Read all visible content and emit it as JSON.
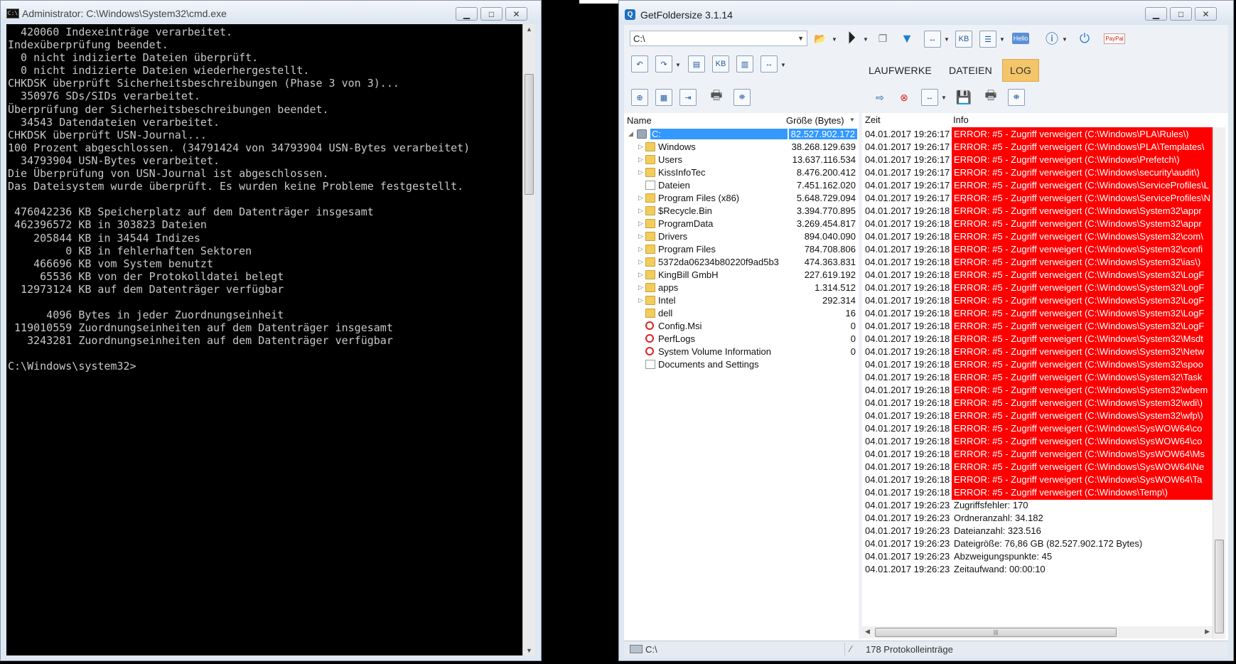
{
  "cmd": {
    "title": "Administrator: C:\\Windows\\System32\\cmd.exe",
    "icon_text": "C:\\",
    "output": "  420060 Indexeinträge verarbeitet.\nIndexüberprüfung beendet.\n  0 nicht indizierte Dateien überprüft.\n  0 nicht indizierte Dateien wiederhergestellt.\nCHKDSK überprüft Sicherheitsbeschreibungen (Phase 3 von 3)...\n  350976 SDs/SIDs verarbeitet.\nÜberprüfung der Sicherheitsbeschreibungen beendet.\n  34543 Datendateien verarbeitet.\nCHKDSK überprüft USN-Journal...\n100 Prozent abgeschlossen. (34791424 von 34793904 USN-Bytes verarbeitet)\n  34793904 USN-Bytes verarbeitet.\nDie Überprüfung von USN-Journal ist abgeschlossen.\nDas Dateisystem wurde überprüft. Es wurden keine Probleme festgestellt.\n\n 476042236 KB Speicherplatz auf dem Datenträger insgesamt\n 462396572 KB in 303823 Dateien\n    205844 KB in 34544 Indizes\n         0 KB in fehlerhaften Sektoren\n    466696 KB vom System benutzt\n     65536 KB von der Protokolldatei belegt\n  12973124 KB auf dem Datenträger verfügbar\n\n      4096 Bytes in jeder Zuordnungseinheit\n 119010559 Zuordnungseinheiten auf dem Datenträger insgesamt\n   3243281 Zuordnungseinheiten auf dem Datenträger verfügbar\n\nC:\\Windows\\system32>"
  },
  "gfs": {
    "title": "GetFoldersize 3.1.14",
    "path_value": "C:\\",
    "tabs": [
      {
        "label": "LAUFWERKE"
      },
      {
        "label": "DATEIEN"
      },
      {
        "label": "LOG"
      }
    ],
    "toolbar_labels": {
      "kb": "KB",
      "hello": "Hello",
      "paypal": "PayPal"
    },
    "tree_headers": {
      "name": "Name",
      "size": "Größe (Bytes)"
    },
    "tree": [
      {
        "name": "C:",
        "size": "82.527.902.172",
        "type": "drive"
      },
      {
        "name": "Windows",
        "size": "38.268.129.639",
        "type": "folder"
      },
      {
        "name": "Users",
        "size": "13.637.116.534",
        "type": "folder"
      },
      {
        "name": "KissInfoTec",
        "size": "8.476.200.412",
        "type": "folder"
      },
      {
        "name": "Dateien",
        "size": "7.451.162.020",
        "type": "file"
      },
      {
        "name": "Program Files (x86)",
        "size": "5.648.729.094",
        "type": "folder"
      },
      {
        "name": "$Recycle.Bin",
        "size": "3.394.770.895",
        "type": "folder"
      },
      {
        "name": "ProgramData",
        "size": "3.269.454.817",
        "type": "folder"
      },
      {
        "name": "Drivers",
        "size": "894.040.090",
        "type": "folder"
      },
      {
        "name": "Program Files",
        "size": "784.708.806",
        "type": "folder"
      },
      {
        "name": "5372da06234b80220f9ad5b3",
        "size": "474.363.831",
        "type": "folder"
      },
      {
        "name": "KingBill GmbH",
        "size": "227.619.192",
        "type": "folder"
      },
      {
        "name": "apps",
        "size": "1.314.512",
        "type": "folder"
      },
      {
        "name": "Intel",
        "size": "292.314",
        "type": "folder"
      },
      {
        "name": "dell",
        "size": "16",
        "type": "folder"
      },
      {
        "name": "Config.Msi",
        "size": "0",
        "type": "noent"
      },
      {
        "name": "PerfLogs",
        "size": "0",
        "type": "noent"
      },
      {
        "name": "System Volume Information",
        "size": "0",
        "type": "noent"
      },
      {
        "name": "Documents and Settings",
        "size": "",
        "type": "link"
      }
    ],
    "log_headers": {
      "time": "Zeit",
      "info": "Info"
    },
    "log": [
      {
        "time": "04.01.2017 19:26:17",
        "info": "ERROR: #5 - Zugriff verweigert (C:\\Windows\\PLA\\Rules\\)",
        "error": true
      },
      {
        "time": "04.01.2017 19:26:17",
        "info": "ERROR: #5 - Zugriff verweigert (C:\\Windows\\PLA\\Templates\\",
        "error": true
      },
      {
        "time": "04.01.2017 19:26:17",
        "info": "ERROR: #5 - Zugriff verweigert (C:\\Windows\\Prefetch\\)",
        "error": true
      },
      {
        "time": "04.01.2017 19:26:17",
        "info": "ERROR: #5 - Zugriff verweigert (C:\\Windows\\security\\audit\\)",
        "error": true
      },
      {
        "time": "04.01.2017 19:26:17",
        "info": "ERROR: #5 - Zugriff verweigert (C:\\Windows\\ServiceProfiles\\L",
        "error": true
      },
      {
        "time": "04.01.2017 19:26:17",
        "info": "ERROR: #5 - Zugriff verweigert (C:\\Windows\\ServiceProfiles\\N",
        "error": true
      },
      {
        "time": "04.01.2017 19:26:18",
        "info": "ERROR: #5 - Zugriff verweigert (C:\\Windows\\System32\\appr",
        "error": true
      },
      {
        "time": "04.01.2017 19:26:18",
        "info": "ERROR: #5 - Zugriff verweigert (C:\\Windows\\System32\\appr",
        "error": true
      },
      {
        "time": "04.01.2017 19:26:18",
        "info": "ERROR: #5 - Zugriff verweigert (C:\\Windows\\System32\\com\\",
        "error": true
      },
      {
        "time": "04.01.2017 19:26:18",
        "info": "ERROR: #5 - Zugriff verweigert (C:\\Windows\\System32\\confi",
        "error": true
      },
      {
        "time": "04.01.2017 19:26:18",
        "info": "ERROR: #5 - Zugriff verweigert (C:\\Windows\\System32\\ias\\)",
        "error": true
      },
      {
        "time": "04.01.2017 19:26:18",
        "info": "ERROR: #5 - Zugriff verweigert (C:\\Windows\\System32\\LogF",
        "error": true
      },
      {
        "time": "04.01.2017 19:26:18",
        "info": "ERROR: #5 - Zugriff verweigert (C:\\Windows\\System32\\LogF",
        "error": true
      },
      {
        "time": "04.01.2017 19:26:18",
        "info": "ERROR: #5 - Zugriff verweigert (C:\\Windows\\System32\\LogF",
        "error": true
      },
      {
        "time": "04.01.2017 19:26:18",
        "info": "ERROR: #5 - Zugriff verweigert (C:\\Windows\\System32\\LogF",
        "error": true
      },
      {
        "time": "04.01.2017 19:26:18",
        "info": "ERROR: #5 - Zugriff verweigert (C:\\Windows\\System32\\LogF",
        "error": true
      },
      {
        "time": "04.01.2017 19:26:18",
        "info": "ERROR: #5 - Zugriff verweigert (C:\\Windows\\System32\\Msdt",
        "error": true
      },
      {
        "time": "04.01.2017 19:26:18",
        "info": "ERROR: #5 - Zugriff verweigert (C:\\Windows\\System32\\Netw",
        "error": true
      },
      {
        "time": "04.01.2017 19:26:18",
        "info": "ERROR: #5 - Zugriff verweigert (C:\\Windows\\System32\\spoo",
        "error": true
      },
      {
        "time": "04.01.2017 19:26:18",
        "info": "ERROR: #5 - Zugriff verweigert (C:\\Windows\\System32\\Task",
        "error": true
      },
      {
        "time": "04.01.2017 19:26:18",
        "info": "ERROR: #5 - Zugriff verweigert (C:\\Windows\\System32\\wbem",
        "error": true
      },
      {
        "time": "04.01.2017 19:26:18",
        "info": "ERROR: #5 - Zugriff verweigert (C:\\Windows\\System32\\wdi\\)",
        "error": true
      },
      {
        "time": "04.01.2017 19:26:18",
        "info": "ERROR: #5 - Zugriff verweigert (C:\\Windows\\System32\\wfp\\)",
        "error": true
      },
      {
        "time": "04.01.2017 19:26:18",
        "info": "ERROR: #5 - Zugriff verweigert (C:\\Windows\\SysWOW64\\co",
        "error": true
      },
      {
        "time": "04.01.2017 19:26:18",
        "info": "ERROR: #5 - Zugriff verweigert (C:\\Windows\\SysWOW64\\co",
        "error": true
      },
      {
        "time": "04.01.2017 19:26:18",
        "info": "ERROR: #5 - Zugriff verweigert (C:\\Windows\\SysWOW64\\Ms",
        "error": true
      },
      {
        "time": "04.01.2017 19:26:18",
        "info": "ERROR: #5 - Zugriff verweigert (C:\\Windows\\SysWOW64\\Ne",
        "error": true
      },
      {
        "time": "04.01.2017 19:26:18",
        "info": "ERROR: #5 - Zugriff verweigert (C:\\Windows\\SysWOW64\\Ta",
        "error": true
      },
      {
        "time": "04.01.2017 19:26:18",
        "info": "ERROR: #5 - Zugriff verweigert (C:\\Windows\\Temp\\)",
        "error": true
      },
      {
        "time": "04.01.2017 19:26:23",
        "info": "Zugriffsfehler: 170",
        "error": false
      },
      {
        "time": "04.01.2017 19:26:23",
        "info": "Ordneranzahl: 34.182",
        "error": false
      },
      {
        "time": "04.01.2017 19:26:23",
        "info": "Dateianzahl: 323.516",
        "error": false
      },
      {
        "time": "04.01.2017 19:26:23",
        "info": "Dateigröße: 76,86 GB (82.527.902.172 Bytes)",
        "error": false
      },
      {
        "time": "04.01.2017 19:26:23",
        "info": "Abzweigungspunkte: 45",
        "error": false
      },
      {
        "time": "04.01.2017 19:26:23",
        "info": "Zeitaufwand: 00:00:10",
        "error": false
      }
    ],
    "status": {
      "path": "C:\\",
      "entries": "178 Protokolleinträge"
    },
    "colors": {
      "error_bg": "#ff0000",
      "selection": "#3399ff",
      "active_tab": "#f5c56a"
    }
  }
}
